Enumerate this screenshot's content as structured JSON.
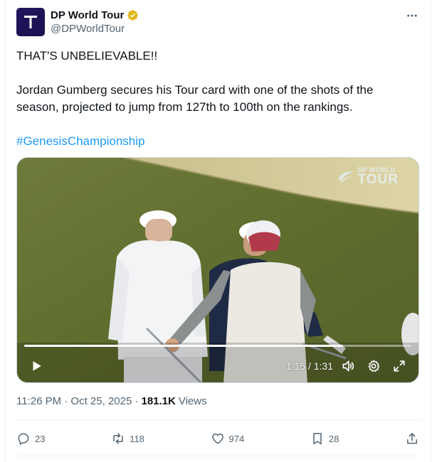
{
  "author": {
    "display_name": "DP World Tour",
    "handle": "@DPWorldTour",
    "verified": true,
    "avatar_letter": "T",
    "avatar_color": "#1f1459"
  },
  "tweet": {
    "line1": "THAT'S UNBELIEVABLE!!",
    "body": "Jordan Gumberg secures his Tour card with one of the shots of the season, projected to jump from 127th to 100th on the rankings.",
    "hashtag": "#GenesisChampionship"
  },
  "media": {
    "watermark_small": "DP WORLD",
    "watermark_big": "TOUR",
    "time_display": "1:15 / 1:31",
    "progress_fraction": 0.824
  },
  "meta": {
    "timestamp": "11:26 PM · Oct 25, 2025 ·",
    "views_count": "181.1K",
    "views_label": "Views"
  },
  "actions": {
    "replies": "23",
    "reposts": "118",
    "likes": "974",
    "bookmarks": "28"
  },
  "colors": {
    "link": "#1d9bf0",
    "verified_badge": "#e2b719",
    "secondary_text": "#536471"
  }
}
